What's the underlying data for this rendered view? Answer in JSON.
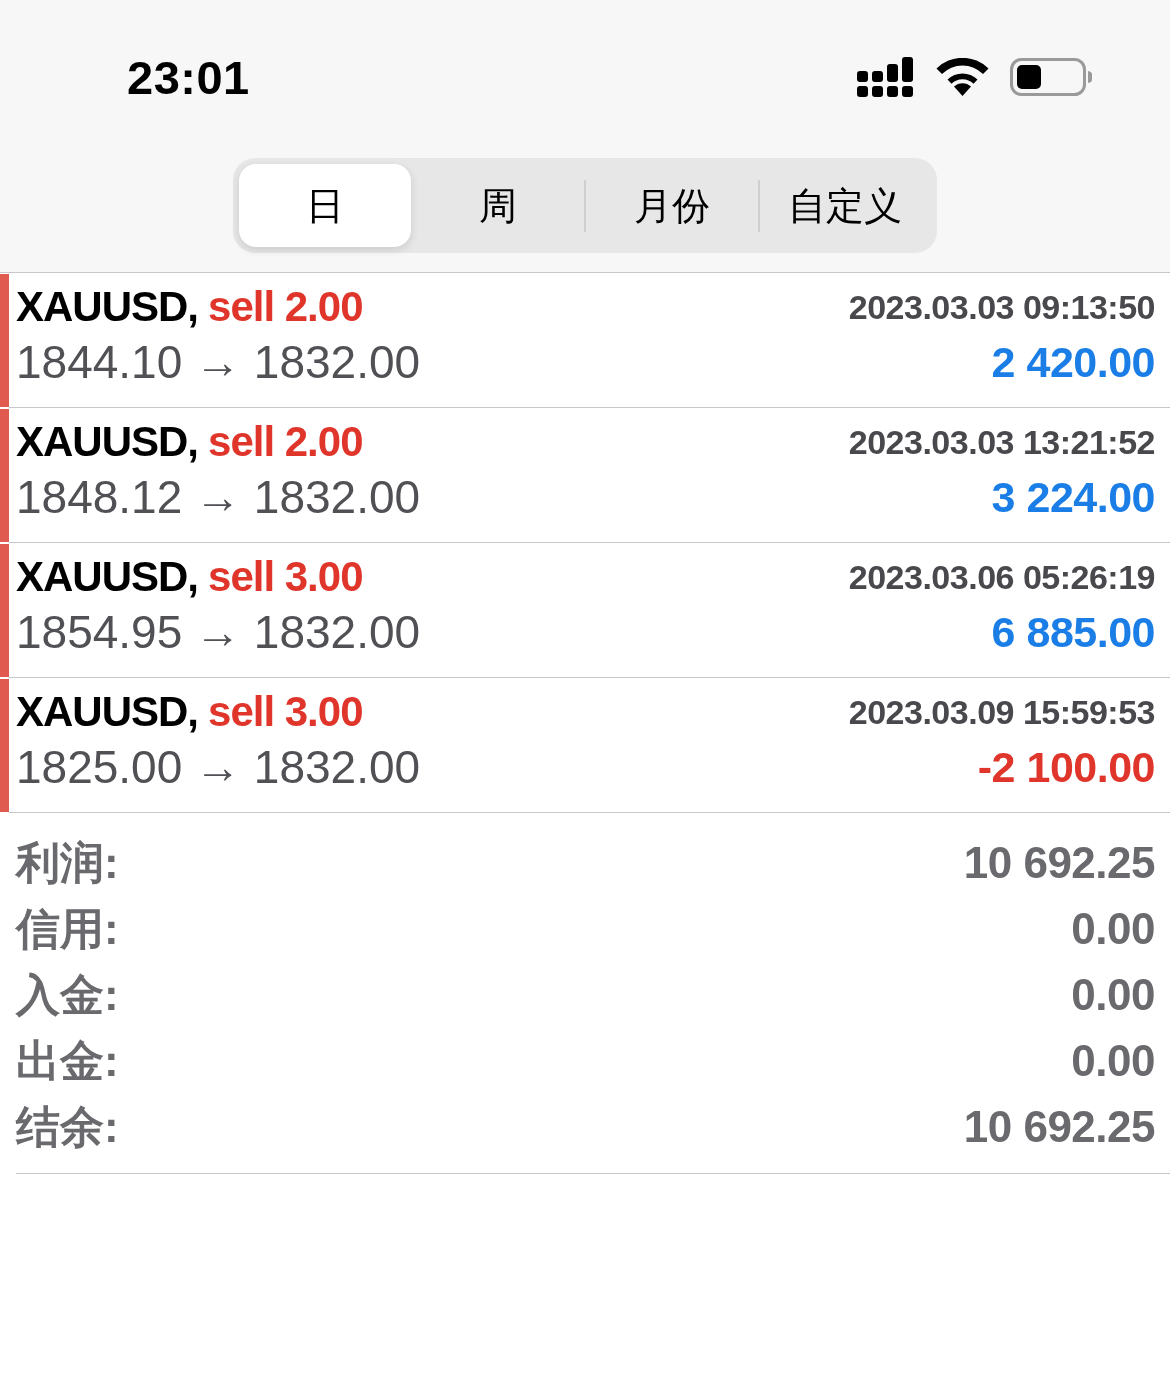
{
  "status_bar": {
    "time": "23:01"
  },
  "period_tabs": [
    {
      "label": "日",
      "selected": true
    },
    {
      "label": "周",
      "selected": false
    },
    {
      "label": "月份",
      "selected": false
    },
    {
      "label": "自定义",
      "selected": false
    }
  ],
  "deals": [
    {
      "kind": "sell",
      "symbol": "XAUUSD,",
      "order": "sell 2.00",
      "time": "2023.03.03 09:13:50",
      "prices": "1844.10 → 1832.00",
      "profit": "2 420.00",
      "loss": false
    },
    {
      "kind": "sell",
      "symbol": "XAUUSD,",
      "order": "sell 2.00",
      "time": "2023.03.03 13:21:52",
      "prices": "1848.12 → 1832.00",
      "profit": "3 224.00",
      "loss": false
    },
    {
      "kind": "sell",
      "symbol": "XAUUSD,",
      "order": "sell 3.00",
      "time": "2023.03.06 05:26:19",
      "prices": "1854.95 → 1832.00",
      "profit": "6 885.00",
      "loss": false
    },
    {
      "kind": "sell",
      "symbol": "XAUUSD,",
      "order": "sell 3.00",
      "time": "2023.03.09 15:59:53",
      "prices": "1825.00 → 1832.00",
      "profit": "-2 100.00",
      "loss": true
    }
  ],
  "summary": [
    {
      "label": "利润:",
      "value": "10 692.25"
    },
    {
      "label": "信用:",
      "value": "0.00"
    },
    {
      "label": "入金:",
      "value": "0.00"
    },
    {
      "label": "出金:",
      "value": "0.00"
    },
    {
      "label": "结余:",
      "value": "10 692.25"
    }
  ]
}
